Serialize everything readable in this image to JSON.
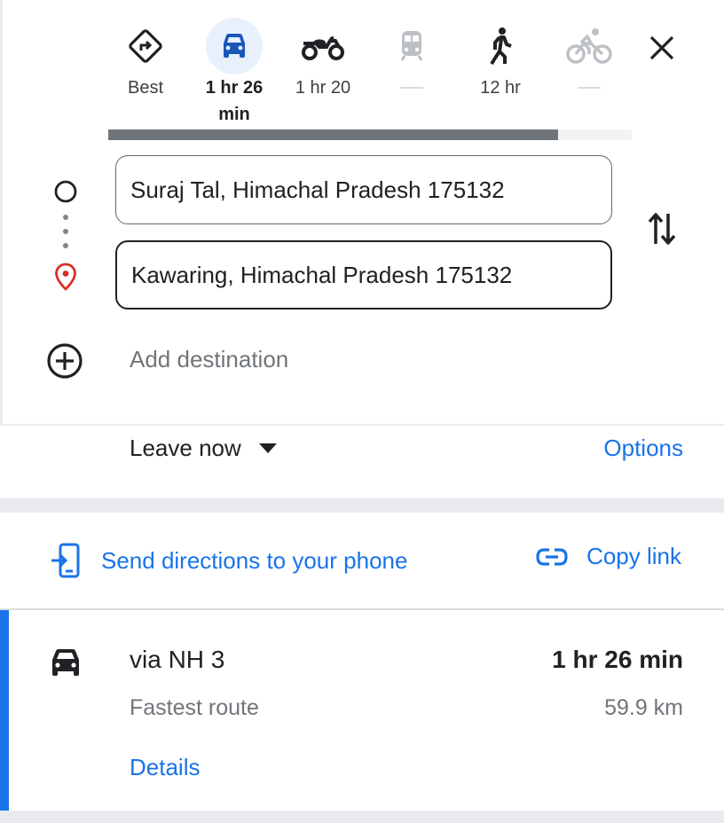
{
  "modes": [
    {
      "name": "best",
      "label": "Best",
      "icon": "directions-icon",
      "selected": false
    },
    {
      "name": "driving",
      "label": "1 hr 26 min",
      "icon": "car-icon",
      "selected": true
    },
    {
      "name": "two-wheeler",
      "label": "1 hr 20",
      "icon": "motorcycle-icon",
      "selected": false
    },
    {
      "name": "transit",
      "label": "",
      "icon": "train-icon",
      "selected": false,
      "disabled": true
    },
    {
      "name": "walking",
      "label": "12 hr",
      "icon": "walking-icon",
      "selected": false
    },
    {
      "name": "cycling",
      "label": "",
      "icon": "bicycle-icon",
      "selected": false,
      "disabled": true
    }
  ],
  "progress": 0.86,
  "origin": {
    "value": "Suraj Tal, Himachal Pradesh 175132"
  },
  "destination": {
    "value": "Kawaring, Himachal Pradesh 175132"
  },
  "add_destination": "Add destination",
  "leave_now": "Leave now",
  "options": "Options",
  "send_directions": "Send directions to your phone",
  "copy_link": "Copy link",
  "route": {
    "name": "via NH 3",
    "subtitle": "Fastest route",
    "time": "1 hr 26 min",
    "distance": "59.9 km",
    "details": "Details"
  },
  "colors": {
    "accent": "#1a73e8",
    "selected_bg": "#e8f0fe",
    "origin_red": "#d93025"
  }
}
